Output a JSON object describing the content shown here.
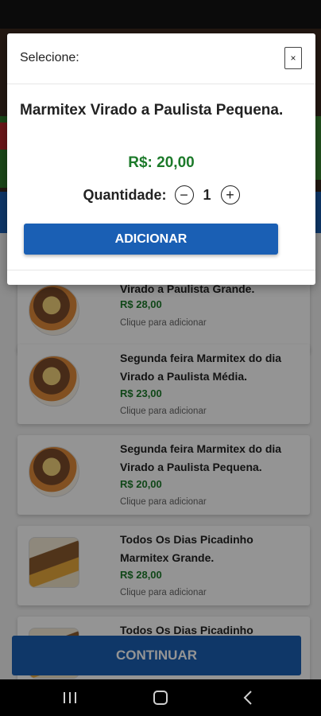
{
  "modal": {
    "title": "Selecione:",
    "close_label": "×",
    "product_name": "Marmitex Virado a Paulista Pequena.",
    "price": "R$: 20,00",
    "quantity_label": "Quantidade:",
    "quantity_value": "1",
    "minus_label": "−",
    "plus_label": "+",
    "add_button_label": "ADICIONAR"
  },
  "items": [
    {
      "title": "Virado a Paulista Grande.",
      "price": "R$ 28,00",
      "hint": "Clique para adicionar",
      "image": "marmitex-plate"
    },
    {
      "title": "Segunda feira Marmitex do dia Virado a Paulista Média.",
      "price": "R$ 23,00",
      "hint": "Clique para adicionar",
      "image": "marmitex-plate"
    },
    {
      "title": "Segunda feira Marmitex do dia Virado a Paulista Pequena.",
      "price": "R$ 20,00",
      "hint": "Clique para adicionar",
      "image": "marmitex-plate"
    },
    {
      "title": "Todos Os Dias Picadinho Marmitex Grande.",
      "price": "R$ 28,00",
      "hint": "Clique para adicionar",
      "image": "picadinho-box"
    },
    {
      "title": "Todos Os Dias Picadinho",
      "price": "",
      "hint": "",
      "image": "picadinho-box"
    }
  ],
  "footer": {
    "continue_label": "CONTINUAR"
  },
  "colors": {
    "primary": "#1a5fb4",
    "price_green": "#1c7a2a"
  },
  "nav": {
    "recents_icon": "recents-icon",
    "home_icon": "home-icon",
    "back_icon": "back-icon"
  }
}
